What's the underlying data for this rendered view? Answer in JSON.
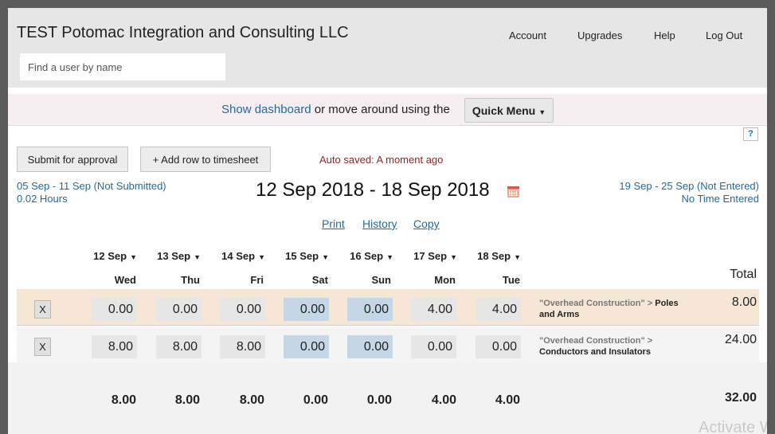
{
  "header": {
    "company": "TEST Potomac Integration and Consulting LLC",
    "search_placeholder": "Find a user by name",
    "nav": [
      "Account",
      "Upgrades",
      "Help",
      "Log Out"
    ]
  },
  "quickbar": {
    "dashboard_link": "Show dashboard",
    "text": "or move around using the",
    "menu_label": "Quick Menu"
  },
  "help_label": "?",
  "toolbar": {
    "submit_label": "Submit for approval",
    "add_row_label": "+ Add row to timesheet",
    "autosave": "Auto saved: A moment ago"
  },
  "week": {
    "prev_range": "05 Sep - 11 Sep (Not Submitted)",
    "prev_hours": "0.02 Hours",
    "current": "12 Sep 2018 - 18 Sep 2018",
    "next_range": "19 Sep - 25 Sep (Not Entered)",
    "next_hours": "No Time Entered"
  },
  "links": [
    "Print",
    "History",
    "Copy"
  ],
  "days": [
    {
      "date": "12 Sep",
      "name": "Wed"
    },
    {
      "date": "13 Sep",
      "name": "Thu"
    },
    {
      "date": "14 Sep",
      "name": "Fri"
    },
    {
      "date": "15 Sep",
      "name": "Sat"
    },
    {
      "date": "16 Sep",
      "name": "Sun"
    },
    {
      "date": "17 Sep",
      "name": "Mon"
    },
    {
      "date": "18 Sep",
      "name": "Tue"
    }
  ],
  "total_header": "Total",
  "rows": [
    {
      "remove_label": "X",
      "hours": [
        "0.00",
        "0.00",
        "0.00",
        "0.00",
        "0.00",
        "4.00",
        "4.00"
      ],
      "project": "\"Overhead Construction\"",
      "separator": ">",
      "task": "Poles and Arms",
      "total": "8.00"
    },
    {
      "remove_label": "X",
      "hours": [
        "8.00",
        "8.00",
        "8.00",
        "0.00",
        "0.00",
        "0.00",
        "0.00"
      ],
      "project": "\"Overhead Construction\"",
      "separator": ">",
      "task": "Conductors and Insulators",
      "total": "24.00"
    }
  ],
  "column_totals": [
    "8.00",
    "8.00",
    "8.00",
    "0.00",
    "0.00",
    "4.00",
    "4.00"
  ],
  "grand_total": "32.00",
  "watermark": "Activate W"
}
